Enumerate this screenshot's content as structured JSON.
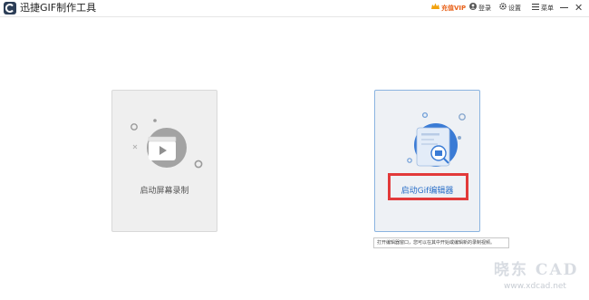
{
  "app": {
    "title": "迅捷GIF制作工具"
  },
  "toolbar": {
    "vip_label": "充值VIP",
    "login_label": "登录",
    "settings_label": "设置",
    "menu_label": "菜单",
    "minimize_icon": "minimize-icon",
    "close_glyph": "✕"
  },
  "cards": {
    "record_label": "启动屏幕录制",
    "editor_label": "启动Gif编辑器"
  },
  "tooltip": {
    "text": "打开编辑器窗口，您可以在其中开始或编辑新的录制视频。"
  },
  "watermark": {
    "main": "晓东 CAD",
    "url": "www.xdcad.net"
  },
  "colors": {
    "vip": "#e8621a",
    "accent_blue": "#2a6fc8",
    "highlight_red": "#e23a3a",
    "card_gray": "#efefef",
    "card_blue": "#eef1f5"
  }
}
